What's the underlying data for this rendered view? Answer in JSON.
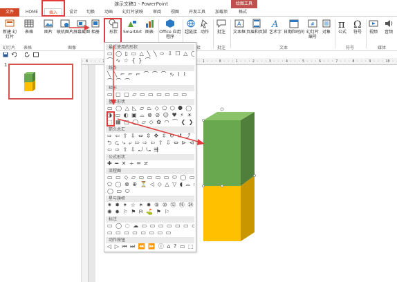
{
  "window": {
    "title": "演示文稿1 - PowerPoint",
    "context_tab": "绘图工具"
  },
  "tabs": [
    {
      "label": "文件"
    },
    {
      "label": "HOME"
    },
    {
      "label": "插入"
    },
    {
      "label": "设计"
    },
    {
      "label": "切换"
    },
    {
      "label": "动画"
    },
    {
      "label": "幻灯片放映"
    },
    {
      "label": "审阅"
    },
    {
      "label": "视图"
    },
    {
      "label": "开发工具"
    },
    {
      "label": "加载项"
    },
    {
      "label": "格式"
    }
  ],
  "ribbon": {
    "buttons": [
      {
        "label": "新建\n幻灯片"
      },
      {
        "label": "表格"
      },
      {
        "label": "图片"
      },
      {
        "label": "联机图片"
      },
      {
        "label": "屏幕截图"
      },
      {
        "label": "相册"
      },
      {
        "label": "形状"
      },
      {
        "label": "SmartArt"
      },
      {
        "label": "图表"
      },
      {
        "label": "Office\n应用程序"
      },
      {
        "label": "超链接"
      },
      {
        "label": "动作"
      },
      {
        "label": "批注"
      },
      {
        "label": "文本框"
      },
      {
        "label": "页眉和页脚"
      },
      {
        "label": "艺术字"
      },
      {
        "label": "日期和时间"
      },
      {
        "label": "幻灯片\n编号"
      },
      {
        "label": "对象"
      },
      {
        "label": "公式"
      },
      {
        "label": "符号"
      },
      {
        "label": "视频"
      },
      {
        "label": "音频"
      }
    ],
    "groups": {
      "slides": "幻灯片",
      "tables": "表格",
      "images": "图像",
      "links": "链接",
      "comments": "批注",
      "text": "文本",
      "symbols": "符号",
      "media": "媒体"
    }
  },
  "thumbnail": {
    "number": "1"
  },
  "ruler": {
    "ticks": "· 8 · · · 7 · · · 6 · · · 5 · · · 4 · · · 3 · · · 2 · · · 1 · · · 0 · · · 1 · · · 2 · · · 3 · · · 4 · · · 5 · · · 6 · · · 7 · · · 8 · · · 9 · · · 10 · · · 11"
  },
  "shapes_gallery": {
    "categories": [
      {
        "label": "最近使用的形状"
      },
      {
        "label": "线条"
      },
      {
        "label": "矩形"
      },
      {
        "label": "基本形状"
      },
      {
        "label": "箭头总汇"
      },
      {
        "label": "公式形状"
      },
      {
        "label": "流程图"
      },
      {
        "label": "星与旗帜"
      },
      {
        "label": "标注"
      },
      {
        "label": "动作按钮"
      }
    ],
    "rows": [
      {
        "glyphs": "▭ ◯ ▯ ▭ △ ╲ ╲ ⇨ ⇩ ☐ △ ◯"
      },
      {
        "glyphs": "⌒ ∿ ☆ { } ⌒"
      },
      {
        "glyphs": "╲ ╲ ⌐ ⌐ ⌐ ⌒ ⌒ ⌒ ∿ ⌇ ⌇"
      },
      {
        "glyphs": "⌒ ⌒ ⌒"
      },
      {
        "glyphs": "▭ ▢ ▢ ▱ ▭ ▭ ▭ ▭ ▭ ▭"
      },
      {
        "glyphs": "▭ ◯ △ ◺ ▱ ⏢ ◇ ⬠ ⬡ ⯃ ◯ ◔"
      },
      {
        "glyphs": "◑ ▭ ◐ ▣ ⌓ ⊗ ⊘ ☺ ♥ ⚡ ☀ ☾"
      },
      {
        "glyphs": "⬚ ▦ ▢ ◯ ▱ ◇ ✿ ◠ ⌒ ❮ ❯"
      },
      {
        "glyphs": "⇨ ⇦ ⇧ ⇩ ⇔ ⇕ ✥ ⇳ ↻ ↺ ⤴ ⤵"
      },
      {
        "glyphs": "⮌ ⮎ ⤷ ⤶ ⇰ ⇨ ⇦ ⇧ ⇩ ⇔ ⊳ ⊲"
      },
      {
        "glyphs": "⇦ ⇨ ⇧ ⇩ ⤾ ⤿ ⇶"
      },
      {
        "glyphs": "✚ ━ ✕ ÷ ═ ≠"
      },
      {
        "glyphs": "▭ ▭ ◇ ▱ ▭ ▭ ▭ ▭ ⬭ ◯ ▭ ◠"
      },
      {
        "glyphs": "⬠ ◯ ⊗ ⊕ ⏳ ◁ ◇ △ ▽ ◖ ⌓ ▭"
      },
      {
        "glyphs": "◯ ▭ ⬭"
      },
      {
        "glyphs": "✷ ✸ ✦ ☆ ✶ ✹ ⑧ ⑩ ⑫ ⑯ ㉔ ㉜"
      },
      {
        "glyphs": "✺ ✹ ⚐ ⚑ ⛿ ⛳ ⚑ ⚐"
      },
      {
        "glyphs": "▭ ◯ ◌ ☁ ▭ ▭ ▭ ▭ ▭ ▭ ▭ ▭"
      },
      {
        "glyphs": "▭ ▭ ▭ ▭ ▭ ▭ ▭ ▭"
      },
      {
        "glyphs": "◁ ▷ ⏮ ⏭ ⏪ ⏩ ⓘ ⌂ ? ▭ ⬚ ☐"
      }
    ]
  },
  "colors": {
    "green": "#6aa84f",
    "yellow": "#ffc000",
    "accent": "#d24726",
    "highlight": "#e03a3a"
  }
}
